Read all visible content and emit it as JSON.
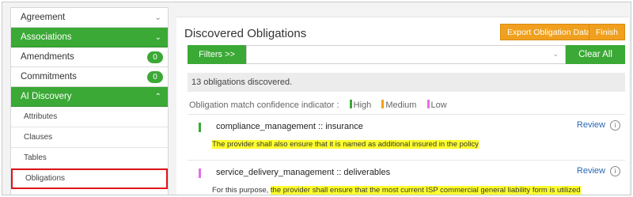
{
  "sidebar": {
    "items": [
      {
        "label": "Agreement",
        "chev": "⌄"
      },
      {
        "label": "Associations",
        "chev": "⌄"
      },
      {
        "label": "Amendments",
        "badge": "0"
      },
      {
        "label": "Commitments",
        "badge": "0"
      },
      {
        "label": "AI Discovery",
        "chev": "⌃"
      }
    ],
    "subitems": [
      "Attributes",
      "Clauses",
      "Tables",
      "Obligations"
    ]
  },
  "main": {
    "title": "Discovered Obligations",
    "export_label": "Export Obligation Data",
    "finish_label": "Finish",
    "filters_label": "Filters >>",
    "filter_chev": "⌄",
    "clear_label": "Clear All",
    "count_text": "13 obligations discovered.",
    "indicator": {
      "label": "Obligation match confidence indicator :",
      "high": "High",
      "medium": "Medium",
      "low": "Low"
    },
    "obligations": [
      {
        "name": "compliance_management :: insurance",
        "pre": "",
        "highlight": "The provider shall also ensure that it is named as additional insured in the policy",
        "review": "Review",
        "info": "i"
      },
      {
        "name": "service_delivery_management :: deliverables",
        "pre": "For this purpose, ",
        "highlight": "the provider shall ensure that the most current ISP commercial general liability form is utilized",
        "review": "Review",
        "info": "i"
      }
    ]
  },
  "colors": {
    "green": "#3aa935",
    "orange": "#f0a01e",
    "high": "#3aa935",
    "medium": "#f0a01e",
    "low": "#e46fe4",
    "highlight": "#ffff2e",
    "selected_border": "#e0141a"
  }
}
